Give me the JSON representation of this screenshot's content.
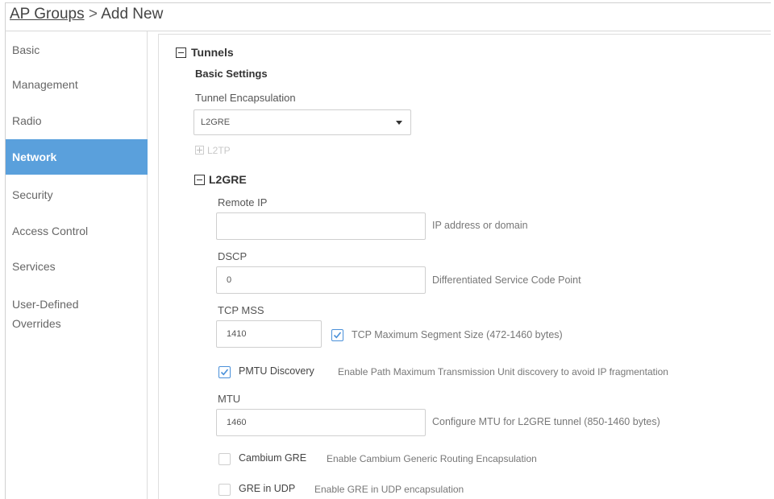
{
  "breadcrumb": {
    "parent": "AP Groups",
    "separator": " > ",
    "current": "Add New"
  },
  "sidebar": {
    "items": [
      {
        "label": "Basic"
      },
      {
        "label": "Management"
      },
      {
        "label": "Radio"
      },
      {
        "label": "Network",
        "active": true
      },
      {
        "label": "Security"
      },
      {
        "label": "Access Control"
      },
      {
        "label": "Services"
      },
      {
        "label": "User-Defined"
      },
      {
        "label": "Overrides"
      }
    ]
  },
  "tunnels": {
    "title": "Tunnels",
    "basic_settings": "Basic Settings",
    "encapsulation_label": "Tunnel Encapsulation",
    "encapsulation_value": "L2GRE",
    "l2tp_label": "L2TP",
    "l2gre_label": "L2GRE"
  },
  "l2gre": {
    "remote_ip": {
      "label": "Remote IP",
      "value": "",
      "hint": "IP address or domain"
    },
    "dscp": {
      "label": "DSCP",
      "value": "0",
      "hint": "Differentiated Service Code Point"
    },
    "tcp_mss": {
      "label": "TCP MSS",
      "value": "1410",
      "hint": "TCP Maximum Segment Size (472-1460 bytes)",
      "checked": true
    },
    "pmtu": {
      "label": "PMTU Discovery",
      "hint": "Enable Path Maximum Transmission Unit discovery to avoid IP fragmentation",
      "checked": true
    },
    "mtu": {
      "label": "MTU",
      "value": "1460",
      "hint": "Configure MTU for L2GRE tunnel (850-1460 bytes)"
    },
    "cambium_gre": {
      "label": "Cambium GRE",
      "hint": "Enable Cambium Generic Routing Encapsulation",
      "checked": false
    },
    "gre_in_udp": {
      "label": "GRE in UDP",
      "hint": "Enable GRE in UDP encapsulation",
      "checked": false
    }
  },
  "colors": {
    "accent": "#5aa0dc",
    "checkbox": "#4a90d9"
  }
}
